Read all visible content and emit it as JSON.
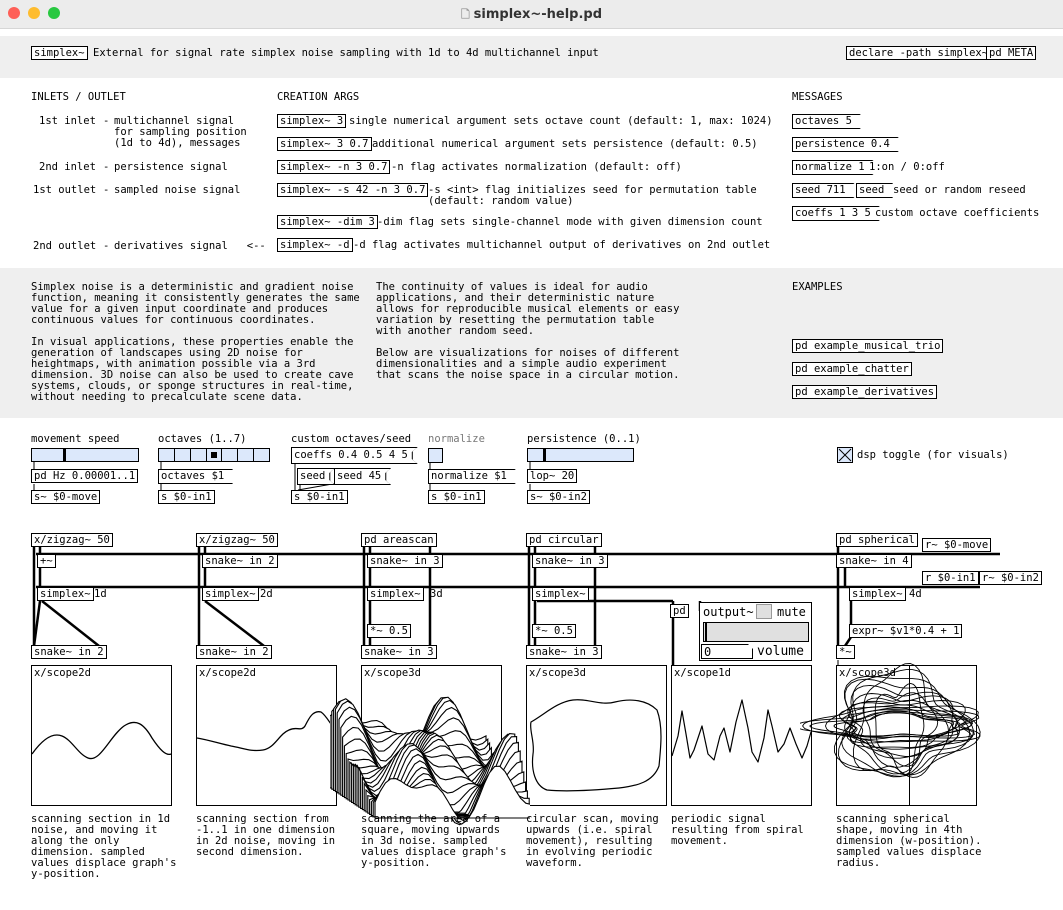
{
  "window": {
    "title": "simplex~-help.pd"
  },
  "header": {
    "object": "simplex~",
    "description": "External for signal rate simplex noise sampling with 1d to 4d multichannel input",
    "declare": "declare -path simplex~",
    "meta": "pd META"
  },
  "io": {
    "heading": "INLETS / OUTLET",
    "rows": [
      {
        "name": "1st inlet",
        "desc": "multichannel signal\nfor sampling position\n(1d to 4d), messages"
      },
      {
        "name": "2nd inlet",
        "desc": "persistence signal"
      },
      {
        "name": "1st outlet",
        "desc": "sampled noise signal"
      },
      {
        "name": "2nd outlet",
        "desc": "derivatives signal   <--"
      }
    ]
  },
  "args": {
    "heading": "CREATION ARGS",
    "rows": [
      {
        "obj": "simplex~ 3",
        "desc": "single numerical argument sets octave count (default: 1, max: 1024)"
      },
      {
        "obj": "simplex~ 3 0.7",
        "desc": "additional numerical argument sets persistence (default: 0.5)"
      },
      {
        "obj": "simplex~ -n 3 0.7",
        "desc": "-n flag activates normalization (default: off)"
      },
      {
        "obj": "simplex~ -s 42 -n 3 0.7",
        "desc": "-s <int> flag initializes seed for permutation table\n(default: random value)"
      },
      {
        "obj": "simplex~ -dim 3",
        "desc": "-dim flag sets single-channel mode with given dimension count"
      },
      {
        "obj": "simplex~ -d",
        "desc": "-d flag activates multichannel output of derivatives on 2nd outlet"
      }
    ]
  },
  "messages": {
    "heading": "MESSAGES",
    "octaves": "octaves 5",
    "persistence": "persistence 0.4",
    "normalize": "normalize 1",
    "normalize_desc": "1:on / 0:off",
    "seed_val": "seed 711",
    "seed": "seed",
    "seed_desc": "seed or random reseed",
    "coeffs": "coeffs 1 3 5",
    "coeffs_desc": "custom octave coefficients"
  },
  "about": {
    "col1": "Simplex noise is a deterministic and gradient noise\nfunction, meaning it consistently generates the same\nvalue for a given input coordinate and produces\ncontinuous values for continuous coordinates.\n\nIn visual applications, these properties enable the\ngeneration of landscapes using 2D noise for\nheightmaps, with animation possible via a 3rd\ndimension. 3D noise can also be used to create cave\nsystems, clouds, or sponge structures in real-time,\nwithout needing to precalculate scene data.",
    "col2": "The continuity of values is ideal for audio\napplications, and their deterministic nature\nallows for reproducible musical elements or easy\nvariation by resetting the permutation table\nwith another random seed.\n\nBelow are visualizations for noises of different\ndimensionalities and a simple audio experiment\nthat scans the noise space in a circular motion.",
    "examples_heading": "EXAMPLES",
    "examples": [
      "pd example_musical_trio",
      "pd example_chatter",
      "pd example_derivatives"
    ]
  },
  "controls": {
    "movement": {
      "label": "movement speed",
      "msg": "pd Hz 0.00001..1",
      "send": "s~ $0-move",
      "value": 0.3
    },
    "octaves": {
      "label": "octaves (1..7)",
      "msg": "octaves $1",
      "send": "s $0-in1",
      "value": 4
    },
    "custom": {
      "label": "custom octaves/seed",
      "coeffs": "coeffs 0.4 0.5 4 5",
      "seed": "seed",
      "seed45": "seed 45",
      "send": "s $0-in1"
    },
    "normalize": {
      "label": "normalize",
      "msg": "normalize $1",
      "send": "s $0-in1"
    },
    "persistence": {
      "label": "persistence (0..1)",
      "msg": "lop~ 20",
      "send": "s~ $0-in2",
      "value": 0.15
    },
    "dsp": {
      "label": "dsp toggle (for visuals)",
      "checked": true
    }
  },
  "patch": {
    "zigzag1": "x/zigzag~ 50",
    "add": "+~",
    "simplex1": "simplex~",
    "note1": "1d",
    "snake1": "snake~ in 2",
    "zigzag2": "x/zigzag~ 50",
    "snakein2": "snake~ in 2",
    "simplex2": "simplex~",
    "note2": "2d",
    "snake2": "snake~ in 2",
    "areascan": "pd areascan",
    "snakein3": "snake~ in 3",
    "simplex3": "simplex~",
    "note3": "3d",
    "mul3": "*~ 0.5",
    "snake3": "snake~ in 3",
    "circular": "pd circular",
    "snakein4": "snake~ in 3",
    "simplex4": "simplex~",
    "mul4": "*~ 0.5",
    "snake4": "snake~ in 3",
    "pd": "pd",
    "output": "output~",
    "mute": "mute",
    "volume_val": "0",
    "volume": "volume",
    "spherical": "pd spherical",
    "rmove": "r~ $0-move",
    "snakein5": "snake~ in 4",
    "rin1": "r $0-in1",
    "rin2": "r~ $0-in2",
    "simplex5": "simplex~",
    "note5": "4d",
    "expr": "expr~ $v1*0.4 + 1",
    "mul5": "*~"
  },
  "scopes": [
    {
      "label": "x/scope2d",
      "caption": "scanning section in 1d\nnoise, and moving it\nalong the only\ndimension. sampled\nvalues displace graph's\ny-position."
    },
    {
      "label": "x/scope2d",
      "caption": "scanning section from\n-1..1 in one dimension\nin 2d noise, moving in\nsecond dimension."
    },
    {
      "label": "x/scope3d",
      "caption": "scanning the area of a\nsquare, moving upwards\nin 3d noise. sampled\nvalues displace graph's\ny-position."
    },
    {
      "label": "x/scope3d",
      "caption": "circular scan, moving\nupwards (i.e. spiral\nmovement), resulting\nin evolving periodic\nwaveform."
    },
    {
      "label": "x/scope1d",
      "caption": "periodic signal\nresulting from spiral\nmovement."
    },
    {
      "label": "x/scope3d",
      "caption": "scanning spherical\nshape, moving in 4th\ndimension (w-position).\nsampled values displace\nradius."
    }
  ]
}
